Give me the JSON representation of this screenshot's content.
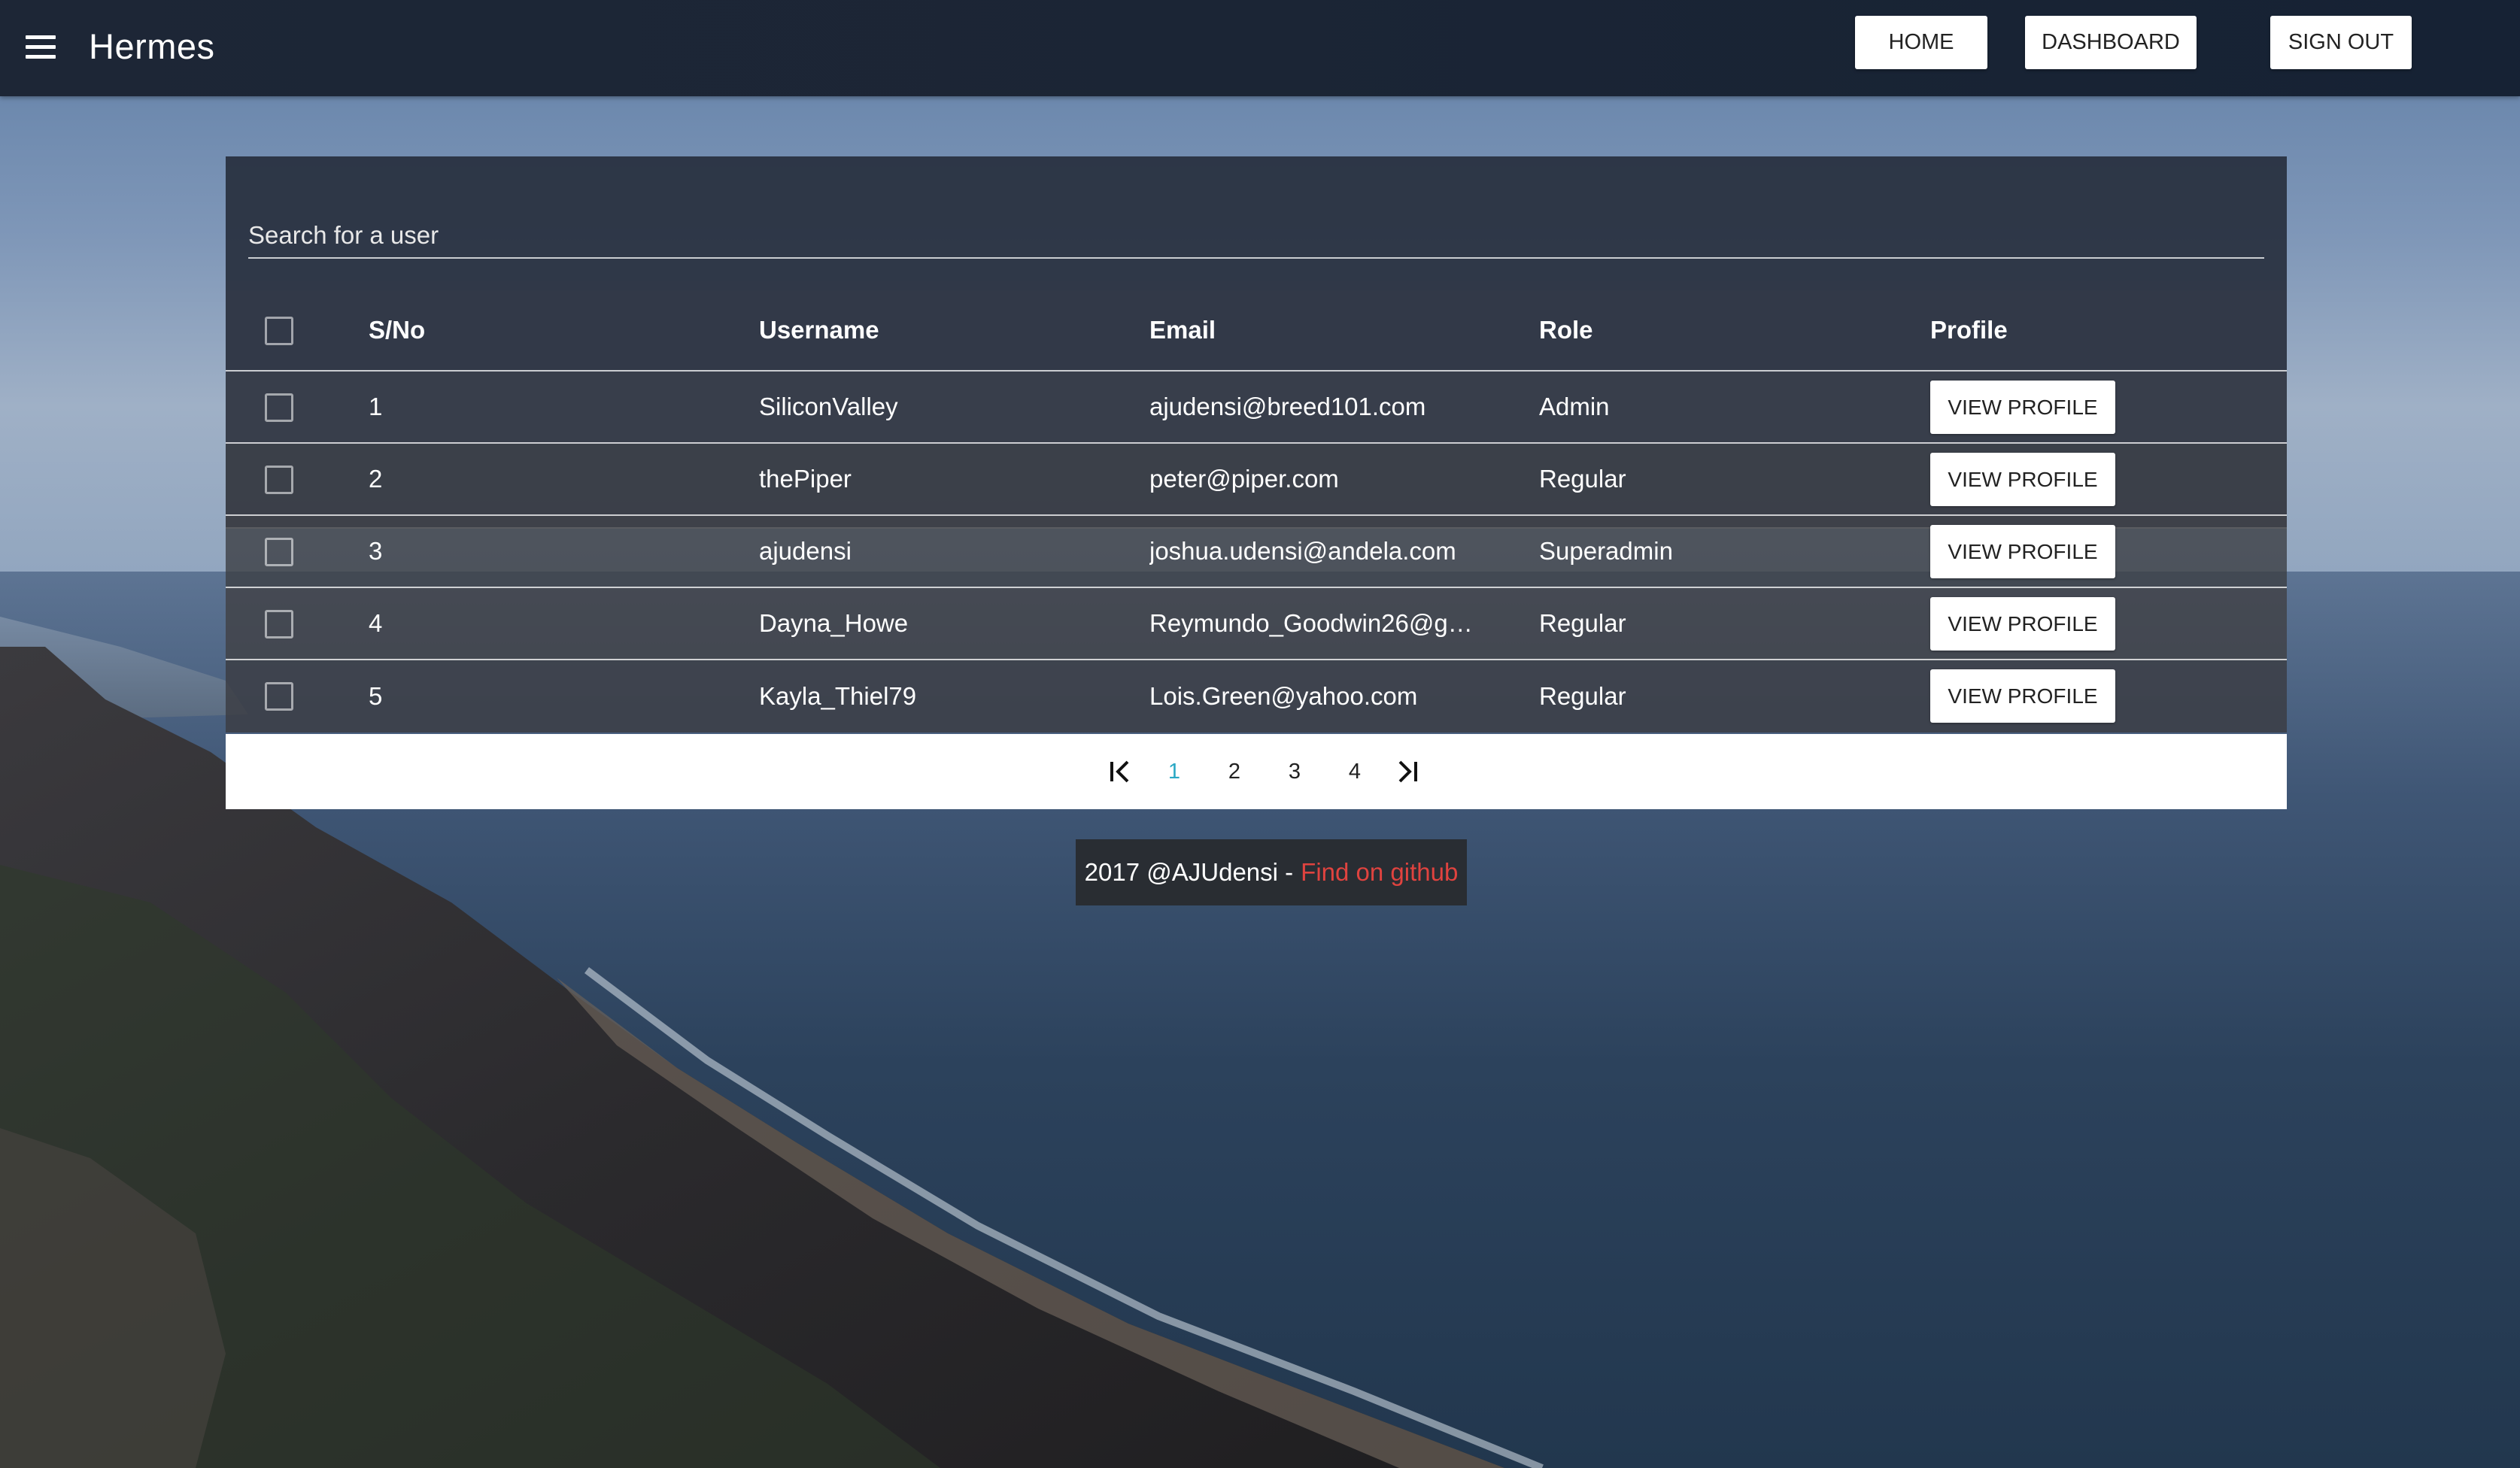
{
  "header": {
    "title": "Hermes",
    "nav": {
      "home": "HOME",
      "dashboard": "DASHBOARD",
      "sign_out": "SIGN OUT"
    }
  },
  "search": {
    "placeholder": "Search for a user"
  },
  "table": {
    "columns": {
      "sno": "S/No",
      "username": "Username",
      "email": "Email",
      "role": "Role",
      "profile": "Profile"
    },
    "rows": [
      {
        "sno": "1",
        "username": "SiliconValley",
        "email": "ajudensi@breed101.com",
        "role": "Admin",
        "action": "VIEW PROFILE"
      },
      {
        "sno": "2",
        "username": "thePiper",
        "email": "peter@piper.com",
        "role": "Regular",
        "action": "VIEW PROFILE"
      },
      {
        "sno": "3",
        "username": "ajudensi",
        "email": "joshua.udensi@andela.com",
        "role": "Superadmin",
        "action": "VIEW PROFILE"
      },
      {
        "sno": "4",
        "username": "Dayna_Howe",
        "email": "Reymundo_Goodwin26@g…",
        "role": "Regular",
        "action": "VIEW PROFILE"
      },
      {
        "sno": "5",
        "username": "Kayla_Thiel79",
        "email": "Lois.Green@yahoo.com",
        "role": "Regular",
        "action": "VIEW PROFILE"
      }
    ]
  },
  "pagination": {
    "first_icon": "first-page-icon",
    "last_icon": "last-page-icon",
    "pages": [
      "1",
      "2",
      "3",
      "4"
    ],
    "current": "1"
  },
  "footer": {
    "text": "2017 @AJUdensi -",
    "link": "Find on github",
    "link_color": "#e0433f"
  },
  "colors": {
    "topbar": "#1b2535",
    "accent_page": "#2aa8c4"
  }
}
